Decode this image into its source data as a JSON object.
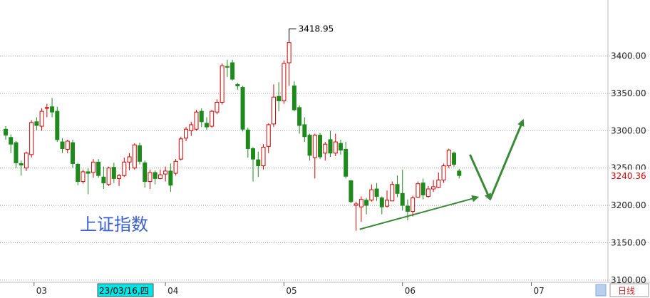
{
  "chart_data": {
    "type": "candlestick",
    "title": "上证指数",
    "y_ticks": [
      3100,
      3150,
      3200,
      3250,
      3300,
      3350,
      3400
    ],
    "y_tick_labels": [
      "3100.00",
      "3150.00",
      "3200.00",
      "3250.00",
      "3300.00",
      "3350.00",
      "3400.00"
    ],
    "ylim": [
      3097,
      3475
    ],
    "x_month_labels": [
      "03",
      "04",
      "05",
      "06",
      "07"
    ],
    "highlighted_date": "23/03/16,四",
    "last_price": "3240.36",
    "high_label": "3418.95",
    "period_label": "日线",
    "colors": {
      "up": "#d40000",
      "down": "#1e8a1e",
      "grid": "#999999",
      "annotation": "#3a8a3a",
      "title": "#3b5fc9",
      "date_box": "#00e5e5"
    },
    "grid": "dashed",
    "candles": [
      [
        3302,
        3306,
        3288,
        3294
      ],
      [
        3291,
        3295,
        3270,
        3282
      ],
      [
        3284,
        3286,
        3250,
        3257
      ],
      [
        3256,
        3260,
        3240,
        3254
      ],
      [
        3250,
        3272,
        3246,
        3270
      ],
      [
        3268,
        3314,
        3264,
        3311
      ],
      [
        3312,
        3318,
        3301,
        3307
      ],
      [
        3306,
        3330,
        3300,
        3326
      ],
      [
        3330,
        3336,
        3318,
        3331
      ],
      [
        3332,
        3344,
        3318,
        3325
      ],
      [
        3326,
        3332,
        3285,
        3288
      ],
      [
        3285,
        3290,
        3270,
        3276
      ],
      [
        3275,
        3288,
        3270,
        3286
      ],
      [
        3284,
        3288,
        3250,
        3256
      ],
      [
        3255,
        3257,
        3227,
        3232
      ],
      [
        3232,
        3248,
        3229,
        3245
      ],
      [
        3245,
        3250,
        3215,
        3243
      ],
      [
        3244,
        3262,
        3237,
        3258
      ],
      [
        3258,
        3262,
        3237,
        3240
      ],
      [
        3238,
        3252,
        3222,
        3230
      ],
      [
        3228,
        3252,
        3226,
        3250
      ],
      [
        3251,
        3257,
        3230,
        3236
      ],
      [
        3236,
        3242,
        3226,
        3240
      ],
      [
        3240,
        3264,
        3238,
        3258
      ],
      [
        3258,
        3270,
        3247,
        3265
      ],
      [
        3250,
        3283,
        3248,
        3281
      ],
      [
        3280,
        3284,
        3255,
        3259
      ],
      [
        3257,
        3260,
        3224,
        3232
      ],
      [
        3232,
        3248,
        3222,
        3244
      ],
      [
        3244,
        3247,
        3228,
        3236
      ],
      [
        3236,
        3248,
        3235,
        3241
      ],
      [
        3242,
        3252,
        3232,
        3246
      ],
      [
        3246,
        3256,
        3218,
        3227
      ],
      [
        3243,
        3262,
        3240,
        3259
      ],
      [
        3262,
        3292,
        3260,
        3289
      ],
      [
        3290,
        3305,
        3286,
        3302
      ],
      [
        3300,
        3312,
        3293,
        3308
      ],
      [
        3302,
        3328,
        3300,
        3325
      ],
      [
        3326,
        3330,
        3305,
        3312
      ],
      [
        3310,
        3318,
        3301,
        3305
      ],
      [
        3306,
        3328,
        3304,
        3326
      ],
      [
        3325,
        3342,
        3322,
        3338
      ],
      [
        3338,
        3390,
        3335,
        3387
      ],
      [
        3386,
        3395,
        3372,
        3385
      ],
      [
        3391,
        3395,
        3367,
        3369
      ],
      [
        3362,
        3364,
        3355,
        3360
      ],
      [
        3358,
        3360,
        3299,
        3302
      ],
      [
        3301,
        3304,
        3264,
        3276
      ],
      [
        3276,
        3278,
        3232,
        3262
      ],
      [
        3261,
        3272,
        3238,
        3253
      ],
      [
        3253,
        3282,
        3248,
        3278
      ],
      [
        3279,
        3310,
        3270,
        3308
      ],
      [
        3309,
        3362,
        3305,
        3345
      ],
      [
        3346,
        3365,
        3326,
        3340
      ],
      [
        3340,
        3394,
        3336,
        3390
      ],
      [
        3391,
        3419,
        3360,
        3418
      ],
      [
        3360,
        3366,
        3326,
        3328
      ],
      [
        3331,
        3334,
        3296,
        3307
      ],
      [
        3308,
        3318,
        3285,
        3292
      ],
      [
        3294,
        3296,
        3260,
        3267
      ],
      [
        3264,
        3296,
        3236,
        3294
      ],
      [
        3294,
        3297,
        3262,
        3265
      ],
      [
        3270,
        3285,
        3260,
        3282
      ],
      [
        3288,
        3300,
        3265,
        3270
      ],
      [
        3270,
        3296,
        3266,
        3285
      ],
      [
        3283,
        3288,
        3268,
        3274
      ],
      [
        3275,
        3285,
        3236,
        3239
      ],
      [
        3233,
        3234,
        3203,
        3205
      ],
      [
        3200,
        3205,
        3166,
        3202
      ],
      [
        3198,
        3212,
        3178,
        3208
      ],
      [
        3207,
        3210,
        3188,
        3200
      ],
      [
        3207,
        3228,
        3205,
        3221
      ],
      [
        3222,
        3230,
        3206,
        3212
      ],
      [
        3210,
        3212,
        3188,
        3198
      ],
      [
        3199,
        3220,
        3197,
        3207
      ],
      [
        3206,
        3232,
        3206,
        3228
      ],
      [
        3228,
        3240,
        3211,
        3216
      ],
      [
        3216,
        3248,
        3193,
        3200
      ],
      [
        3199,
        3208,
        3180,
        3192
      ],
      [
        3192,
        3213,
        3185,
        3210
      ],
      [
        3211,
        3232,
        3210,
        3229
      ],
      [
        3230,
        3236,
        3208,
        3214
      ],
      [
        3212,
        3226,
        3210,
        3222
      ],
      [
        3222,
        3234,
        3218,
        3225
      ],
      [
        3224,
        3244,
        3223,
        3234
      ],
      [
        3234,
        3256,
        3230,
        3253
      ],
      [
        3253,
        3276,
        3250,
        3274
      ],
      [
        3270,
        3272,
        3252,
        3255
      ],
      [
        3246,
        3249,
        3236,
        3240
      ]
    ],
    "annotations": {
      "trend_line": [
        [
          68.7,
          3168
        ],
        [
          91.6,
          3211
        ]
      ],
      "projection_path": [
        [
          90.1,
          3268
        ],
        [
          94.0,
          3208
        ],
        [
          100.4,
          3314
        ]
      ]
    }
  }
}
